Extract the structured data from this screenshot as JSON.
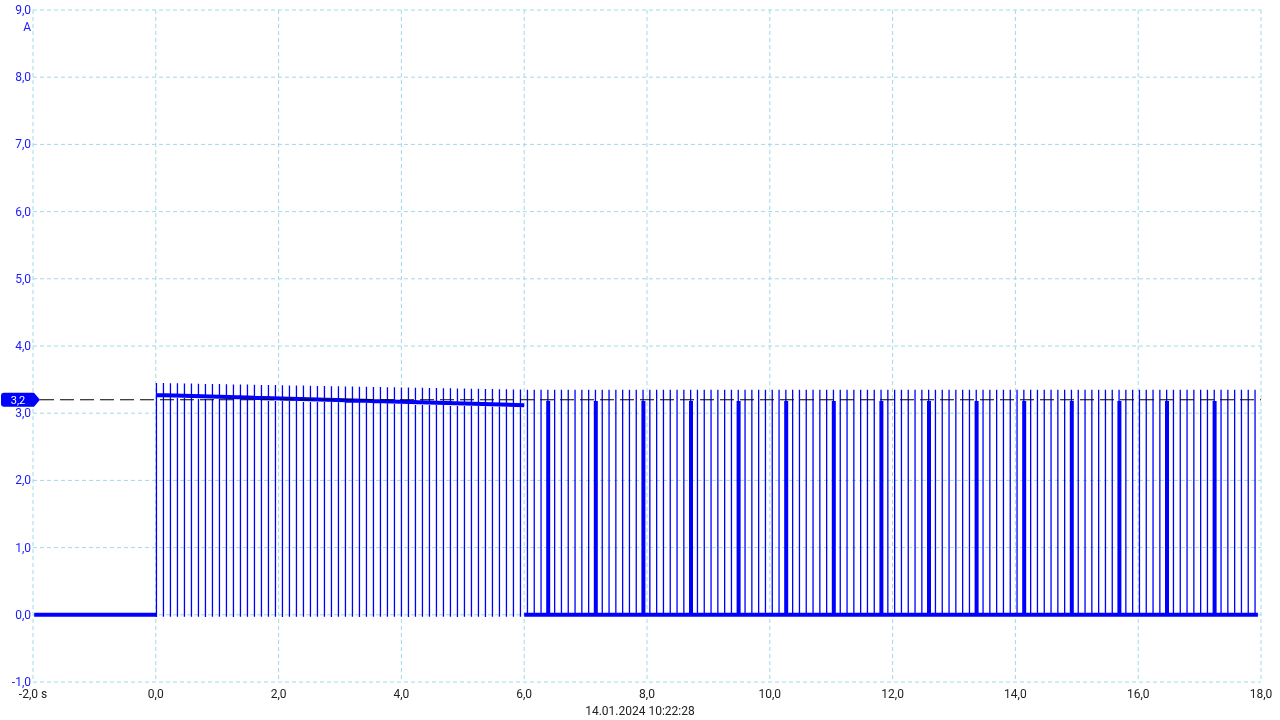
{
  "y_axis": {
    "unit": "A",
    "ticks": [
      "9,0",
      "8,0",
      "7,0",
      "6,0",
      "5,0",
      "4,0",
      "3,0",
      "2,0",
      "1,0",
      "0,0",
      "-1,0"
    ]
  },
  "x_axis": {
    "ticks": [
      "-2,0 s",
      "0,0",
      "2,0",
      "4,0",
      "6,0",
      "8,0",
      "10,0",
      "12,0",
      "14,0",
      "16,0",
      "18,0"
    ]
  },
  "marker": {
    "label": "3,2"
  },
  "timestamp": "14.01.2024 10:22:28"
}
